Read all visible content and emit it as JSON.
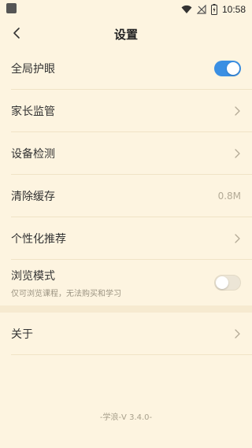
{
  "status_bar": {
    "time": "10:58",
    "icons": [
      "wifi-icon",
      "signal-no-sim-icon",
      "battery-charging-icon"
    ]
  },
  "header": {
    "title": "设置",
    "back_icon": "chevron-left-icon"
  },
  "settings": {
    "eye_protection": {
      "label": "全局护眼",
      "enabled": true
    },
    "parental_control": {
      "label": "家长监管"
    },
    "device_check": {
      "label": "设备检测"
    },
    "clear_cache": {
      "label": "清除缓存",
      "value": "0.8M"
    },
    "recommendation": {
      "label": "个性化推荐"
    },
    "browse_mode": {
      "label": "浏览模式",
      "subtitle": "仅可浏览课程，无法购买和学习",
      "enabled": false
    },
    "about": {
      "label": "关于"
    }
  },
  "footer": {
    "version": "-学浪-V 3.4.0-"
  },
  "colors": {
    "background": "#fdf4e0",
    "toggle_on": "#3a8fe3",
    "divider": "#f0e3c6"
  }
}
